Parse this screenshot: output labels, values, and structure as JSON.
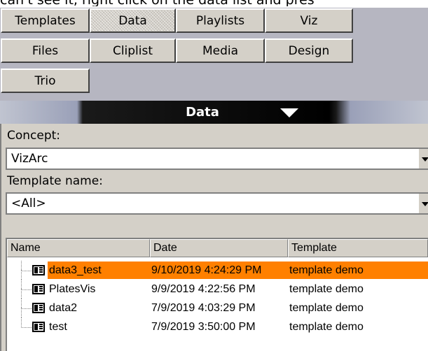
{
  "instruction_text": "can't see it, right click on the data list and pres",
  "tabs": [
    {
      "label": "Templates"
    },
    {
      "label": "Data"
    },
    {
      "label": "Playlists"
    },
    {
      "label": "Viz"
    },
    {
      "label": "Files"
    },
    {
      "label": "Cliplist"
    },
    {
      "label": "Media"
    },
    {
      "label": "Design"
    },
    {
      "label": "Trio"
    }
  ],
  "active_tab": "Data",
  "header": {
    "title": "Data"
  },
  "concept": {
    "label": "Concept:",
    "value": "VizArc"
  },
  "template_name": {
    "label": "Template name:",
    "value": "<All>"
  },
  "list": {
    "columns": [
      "Name",
      "Date",
      "Template"
    ],
    "rows": [
      {
        "name": "data3_test",
        "date": "9/10/2019 4:24:29 PM",
        "template": "template demo",
        "selected": true
      },
      {
        "name": "PlatesVis",
        "date": "9/9/2019 4:22:56 PM",
        "template": "template demo",
        "selected": false
      },
      {
        "name": "data2",
        "date": "7/9/2019 4:03:29 PM",
        "template": "template demo",
        "selected": false
      },
      {
        "name": "test",
        "date": "7/9/2019 3:50:00 PM",
        "template": "template demo",
        "selected": false
      }
    ]
  },
  "colors": {
    "selection": "#ff8000",
    "panel": "#d4d0c8",
    "tabbar_bg": "#b6b6c1"
  }
}
